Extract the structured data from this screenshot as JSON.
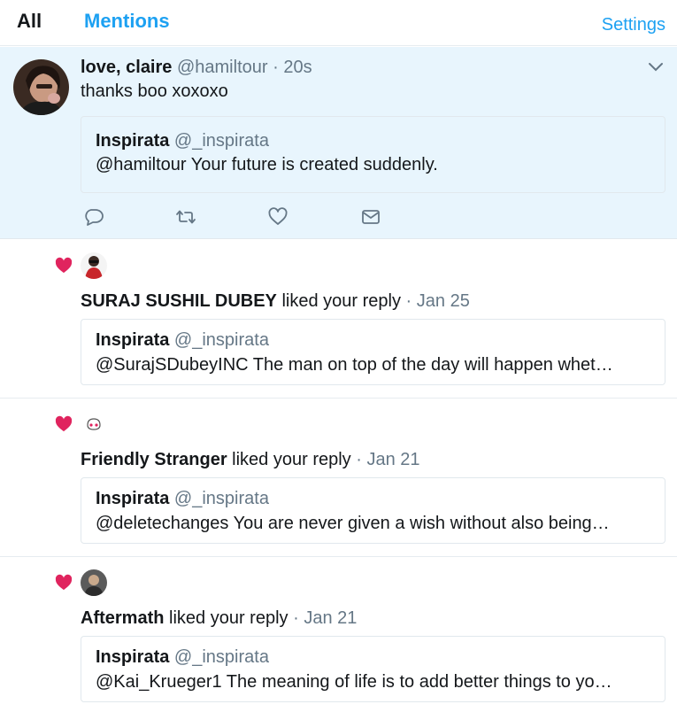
{
  "tabs": {
    "all": "All",
    "mentions": "Mentions",
    "settings": "Settings"
  },
  "tweet": {
    "name": "love, claire",
    "handle": "@hamiltour",
    "separator": "·",
    "time": "20s",
    "text": "thanks boo xoxoxo",
    "quote": {
      "name": "Inspirata",
      "handle": "@_inspirata",
      "text": "@hamiltour Your future is created suddenly."
    },
    "actions": [
      "reply-icon",
      "retweet-icon",
      "like-icon",
      "direct-message-icon"
    ]
  },
  "notifications": [
    {
      "who": "SURAJ SUSHIL DUBEY",
      "action": "liked your reply",
      "separator": "·",
      "date": "Jan 25",
      "quote": {
        "name": "Inspirata",
        "handle": "@_inspirata",
        "text": "@SurajSDubeyINC The man on top of the day will happen whet…"
      }
    },
    {
      "who": "Friendly Stranger",
      "action": "liked your reply",
      "separator": "·",
      "date": "Jan 21",
      "quote": {
        "name": "Inspirata",
        "handle": "@_inspirata",
        "text": "@deletechanges You are never given a wish without also being…"
      }
    },
    {
      "who": "Aftermath",
      "action": "liked your reply",
      "separator": "·",
      "date": "Jan 21",
      "quote": {
        "name": "Inspirata",
        "handle": "@_inspirata",
        "text": "@Kai_Krueger1 The meaning of life is to add better things to yo…"
      }
    }
  ],
  "colors": {
    "accent": "#1da1f2",
    "like": "#e0245e",
    "highlight_bg": "#e8f5fd",
    "muted": "#657786"
  }
}
